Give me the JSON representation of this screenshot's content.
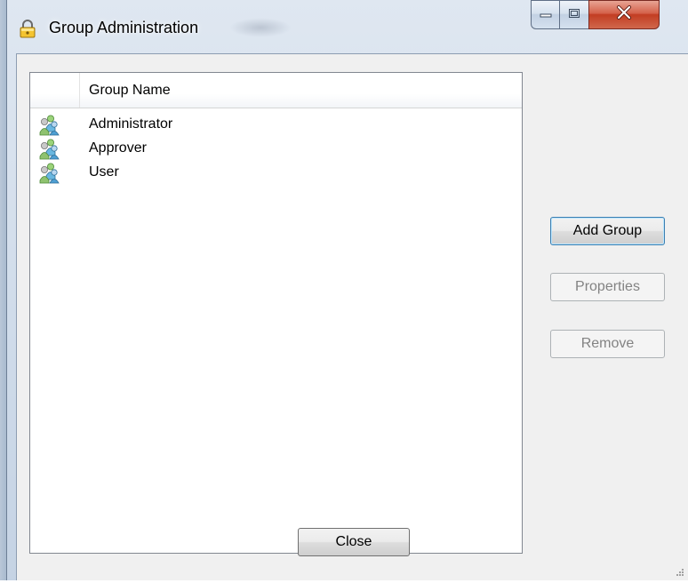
{
  "window": {
    "title": "Group Administration",
    "icon": "padlock-icon",
    "caption_buttons": [
      "minimize-icon",
      "maximize-icon",
      "close-icon"
    ]
  },
  "list": {
    "column_header": "Group Name",
    "row_icon": "group-users-icon",
    "items": [
      {
        "label": "Administrator"
      },
      {
        "label": "Approver"
      },
      {
        "label": "User"
      }
    ]
  },
  "buttons": {
    "add_group": "Add Group",
    "properties": "Properties",
    "remove": "Remove",
    "close": "Close"
  },
  "states": {
    "properties_enabled": false,
    "remove_enabled": false
  },
  "colors": {
    "close_button_red": "#c23d22",
    "window_frame": "#d0dcea",
    "dialog_background": "#f0f0f0",
    "default_button_border": "#3c7fb1"
  }
}
